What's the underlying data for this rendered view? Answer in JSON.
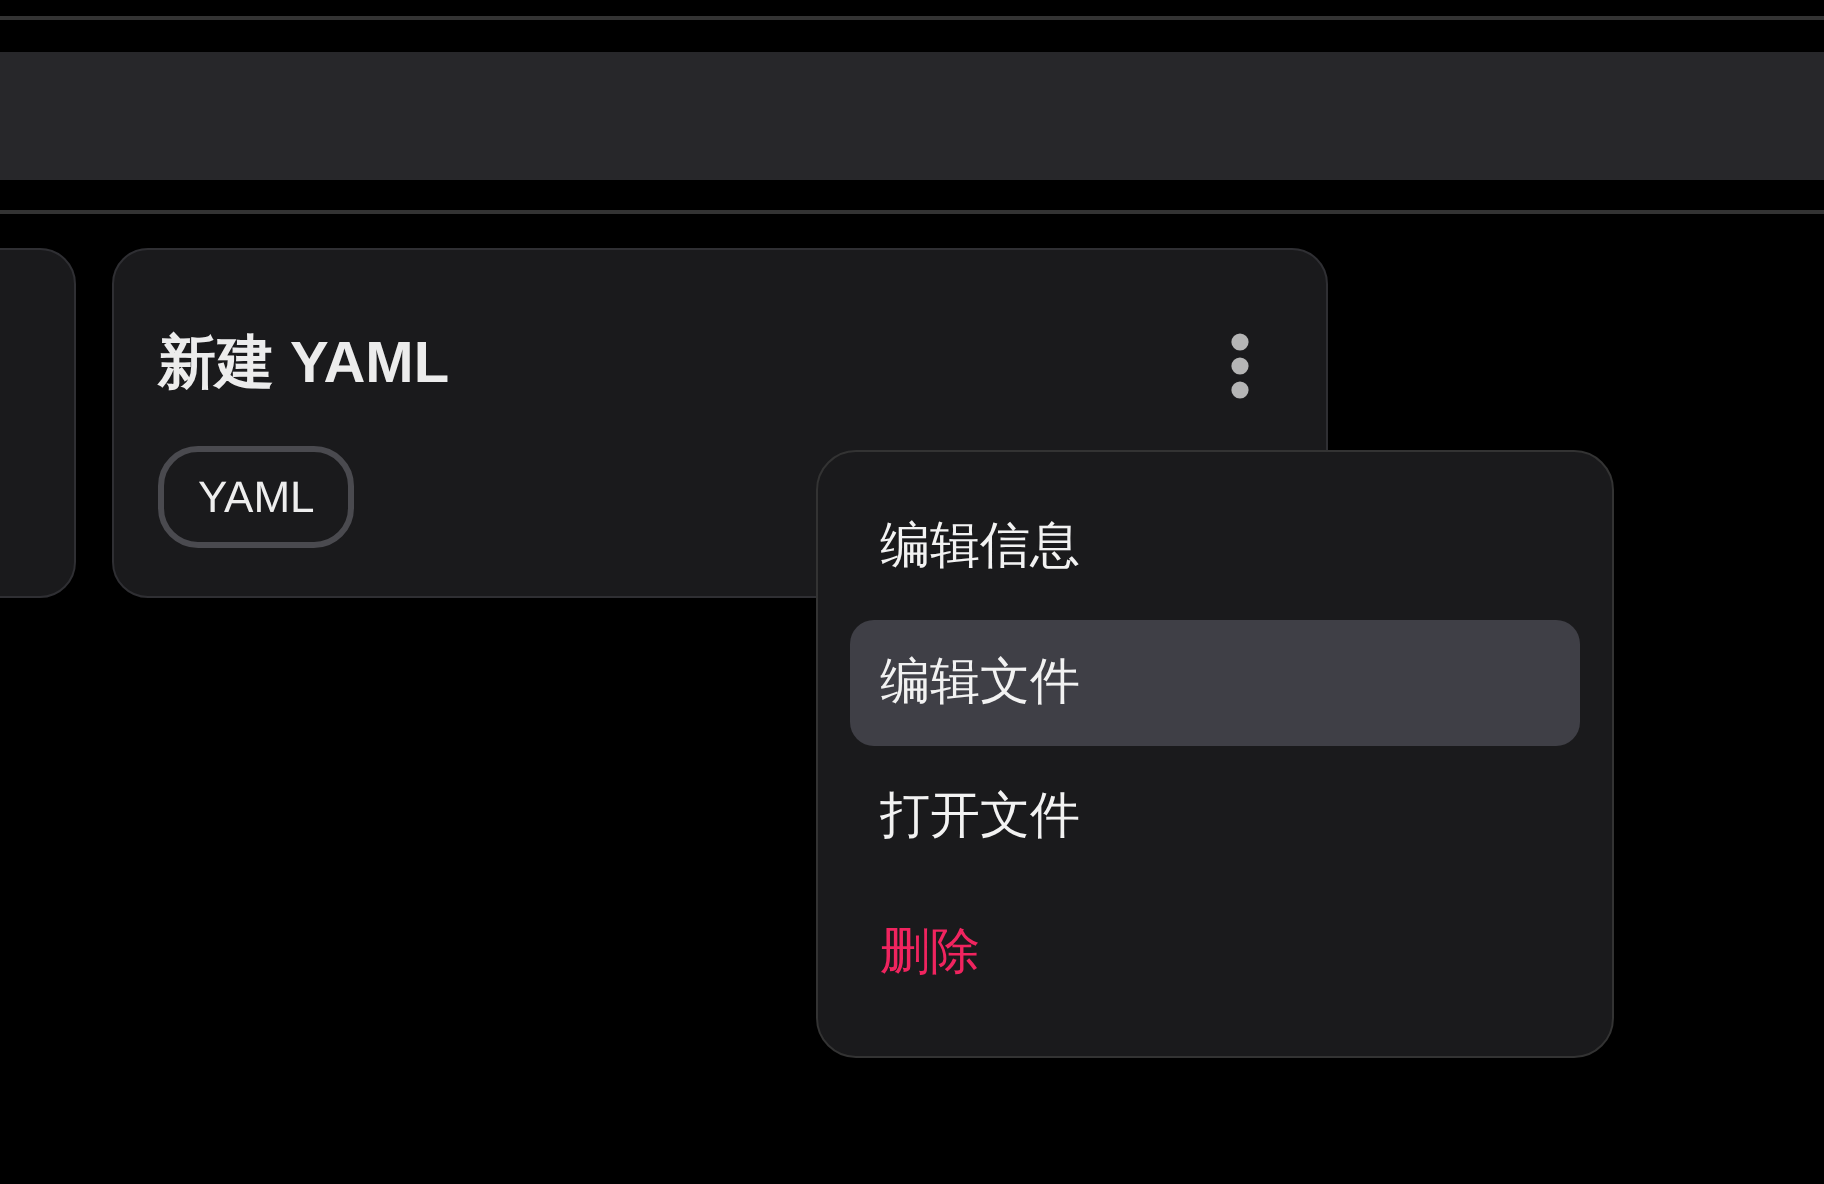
{
  "cards": [
    {
      "title": "新建 YAML",
      "tags": [
        "YAML"
      ]
    }
  ],
  "menu": {
    "items": [
      {
        "label": "编辑信息",
        "kind": "normal",
        "selected": false
      },
      {
        "label": "编辑文件",
        "kind": "normal",
        "selected": true
      },
      {
        "label": "打开文件",
        "kind": "normal",
        "selected": false
      },
      {
        "label": "删除",
        "kind": "danger",
        "selected": false
      }
    ]
  }
}
